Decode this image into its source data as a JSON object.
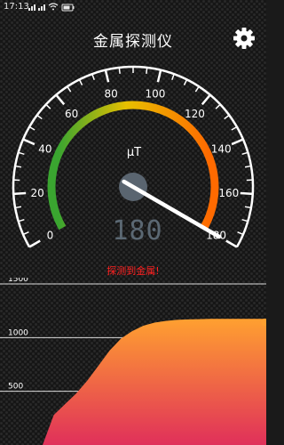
{
  "status_bar": {
    "time": "17:13",
    "icons": [
      "signal-icon",
      "signal-icon",
      "wifi-icon",
      "battery-icon"
    ]
  },
  "app": {
    "title": "金属探测仪",
    "settings_icon": "gear-icon"
  },
  "gauge": {
    "unit": "μT",
    "value": 180,
    "value_display": "180",
    "min": 0,
    "max": 180,
    "tick_labels": [
      "0",
      "20",
      "40",
      "60",
      "80",
      "100",
      "120",
      "140",
      "160",
      "180"
    ],
    "tick_values": [
      0,
      20,
      40,
      60,
      80,
      100,
      120,
      140,
      160,
      180
    ],
    "colors": {
      "low": "#3aa530",
      "mid": "#e8c000",
      "high": "#ff6a00",
      "outer_arc": "#ffffff",
      "needle": "#ffffff",
      "hub": "#5a6570",
      "digital": "#5b6873"
    }
  },
  "status_message": "探测到金属!",
  "chart_data": {
    "type": "area",
    "y_tick_labels": [
      "1500",
      "1000",
      "500"
    ],
    "y_ticks": [
      1500,
      1000,
      500
    ],
    "ylim": [
      0,
      1500
    ],
    "x": [
      0,
      1,
      2,
      3,
      4,
      5,
      6,
      7,
      8,
      9,
      10,
      11,
      12,
      13,
      14,
      15,
      16,
      17,
      18,
      19,
      20
    ],
    "values": [
      0,
      280,
      380,
      480,
      600,
      740,
      880,
      990,
      1060,
      1110,
      1140,
      1155,
      1165,
      1170,
      1172,
      1175,
      1175,
      1175,
      1175,
      1175,
      1175
    ],
    "grid": true,
    "colors": {
      "top": "#ffa030",
      "bottom": "#e0305a",
      "grid": "#ffffff",
      "axis_label": "#ffffff"
    }
  }
}
